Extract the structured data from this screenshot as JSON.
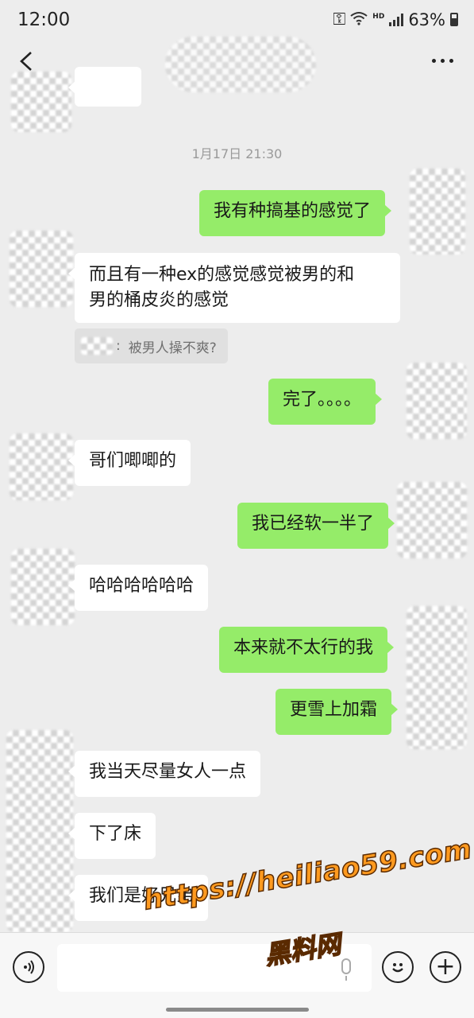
{
  "status_bar": {
    "time": "12:00",
    "net_badge": "HD",
    "battery": "63%"
  },
  "header": {
    "back_icon": "chevron-left-icon",
    "more_icon": "more-dots-icon"
  },
  "chat": {
    "timestamp": "1月17日 21:30",
    "messages": [
      {
        "side": "right",
        "text": "我有种搞基的感觉了"
      },
      {
        "side": "left",
        "text": "而且有一种ex的感觉感觉被男的和\n男的桶皮炎的感觉"
      },
      {
        "side": "right",
        "text": "完了。。。。"
      },
      {
        "side": "left",
        "text": "哥们唧唧的"
      },
      {
        "side": "right",
        "text": "我已经软一半了"
      },
      {
        "side": "left",
        "text": "哈哈哈哈哈哈"
      },
      {
        "side": "right",
        "text": "本来就不太行的我"
      },
      {
        "side": "right",
        "text": "更雪上加霜"
      },
      {
        "side": "left",
        "text": "我当天尽量女人一点"
      },
      {
        "side": "left",
        "text": "下了床"
      },
      {
        "side": "left",
        "text": "我们是好兄弟"
      }
    ],
    "quote": {
      "separator": ":",
      "text": "被男人操不爽?"
    }
  },
  "input_bar": {
    "voice_icon": "voice-icon",
    "emoji_icon": "emoji-icon",
    "plus_icon": "plus-icon",
    "plus_glyph": "+"
  },
  "watermark": {
    "url": "https://heiliao59.com",
    "name": "黑料网"
  },
  "colors": {
    "background": "#ededed",
    "sent_bubble": "#95ec69",
    "received_bubble": "#ffffff",
    "watermark": "#ff9a1f"
  }
}
